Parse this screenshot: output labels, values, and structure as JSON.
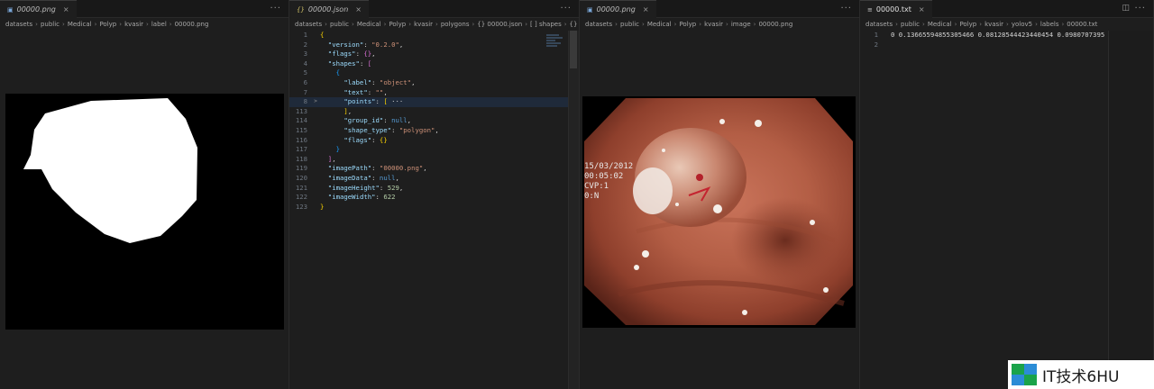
{
  "panes": {
    "mask": {
      "tab_label": "00000.png",
      "breadcrumbs": [
        "datasets",
        "public",
        "Medical",
        "Polyp",
        "kvasir",
        "label",
        "00000.png"
      ]
    },
    "json": {
      "tab_label": "00000.json",
      "breadcrumbs": [
        "datasets",
        "public",
        "Medical",
        "Polyp",
        "kvasir",
        "polygons",
        "{} 00000.json",
        "[ ] shapes",
        "{} 0"
      ],
      "lines": [
        {
          "n": "1",
          "segs": [
            [
              "b",
              "{"
            ]
          ]
        },
        {
          "n": "2",
          "segs": [
            [
              "t",
              "  "
            ],
            [
              "k",
              "\"version\""
            ],
            [
              "t",
              ": "
            ],
            [
              "s",
              "\"0.2.0\""
            ],
            [
              "t",
              ","
            ]
          ]
        },
        {
          "n": "3",
          "segs": [
            [
              "t",
              "  "
            ],
            [
              "k",
              "\"flags\""
            ],
            [
              "t",
              ": "
            ],
            [
              "b2",
              "{}"
            ],
            [
              "t",
              ","
            ]
          ]
        },
        {
          "n": "4",
          "segs": [
            [
              "t",
              "  "
            ],
            [
              "k",
              "\"shapes\""
            ],
            [
              "t",
              ": "
            ],
            [
              "b2",
              "["
            ]
          ]
        },
        {
          "n": "5",
          "segs": [
            [
              "t",
              "    "
            ],
            [
              "b3",
              "{"
            ]
          ]
        },
        {
          "n": "6",
          "segs": [
            [
              "t",
              "      "
            ],
            [
              "k",
              "\"label\""
            ],
            [
              "t",
              ": "
            ],
            [
              "s",
              "\"object\""
            ],
            [
              "t",
              ","
            ]
          ]
        },
        {
          "n": "7",
          "segs": [
            [
              "t",
              "      "
            ],
            [
              "k",
              "\"text\""
            ],
            [
              "t",
              ": "
            ],
            [
              "s",
              "\"\""
            ],
            [
              "t",
              ","
            ]
          ]
        },
        {
          "n": "8",
          "fold": ">",
          "hl": true,
          "segs": [
            [
              "t",
              "      "
            ],
            [
              "k",
              "\"points\""
            ],
            [
              "t",
              ": "
            ],
            [
              "b",
              "["
            ],
            [
              "t",
              " ··· "
            ]
          ]
        },
        {
          "n": "113",
          "segs": [
            [
              "t",
              "      "
            ],
            [
              "b",
              "]"
            ],
            [
              "t",
              ","
            ]
          ]
        },
        {
          "n": "114",
          "segs": [
            [
              "t",
              "      "
            ],
            [
              "k",
              "\"group_id\""
            ],
            [
              "t",
              ": "
            ],
            [
              "nl",
              "null"
            ],
            [
              "t",
              ","
            ]
          ]
        },
        {
          "n": "115",
          "segs": [
            [
              "t",
              "      "
            ],
            [
              "k",
              "\"shape_type\""
            ],
            [
              "t",
              ": "
            ],
            [
              "s",
              "\"polygon\""
            ],
            [
              "t",
              ","
            ]
          ]
        },
        {
          "n": "116",
          "segs": [
            [
              "t",
              "      "
            ],
            [
              "k",
              "\"flags\""
            ],
            [
              "t",
              ": "
            ],
            [
              "b",
              "{}"
            ]
          ]
        },
        {
          "n": "117",
          "segs": [
            [
              "t",
              "    "
            ],
            [
              "b3",
              "}"
            ]
          ]
        },
        {
          "n": "118",
          "segs": [
            [
              "t",
              "  "
            ],
            [
              "b2",
              "]"
            ],
            [
              "t",
              ","
            ]
          ]
        },
        {
          "n": "119",
          "segs": [
            [
              "t",
              "  "
            ],
            [
              "k",
              "\"imagePath\""
            ],
            [
              "t",
              ": "
            ],
            [
              "s",
              "\"00000.png\""
            ],
            [
              "t",
              ","
            ]
          ]
        },
        {
          "n": "120",
          "segs": [
            [
              "t",
              "  "
            ],
            [
              "k",
              "\"imageData\""
            ],
            [
              "t",
              ": "
            ],
            [
              "nl",
              "null"
            ],
            [
              "t",
              ","
            ]
          ]
        },
        {
          "n": "121",
          "segs": [
            [
              "t",
              "  "
            ],
            [
              "k",
              "\"imageHeight\""
            ],
            [
              "t",
              ": "
            ],
            [
              "n",
              "529"
            ],
            [
              "t",
              ","
            ]
          ]
        },
        {
          "n": "122",
          "segs": [
            [
              "t",
              "  "
            ],
            [
              "k",
              "\"imageWidth\""
            ],
            [
              "t",
              ": "
            ],
            [
              "n",
              "622"
            ]
          ]
        },
        {
          "n": "123",
          "segs": [
            [
              "b",
              "}"
            ]
          ]
        }
      ]
    },
    "image": {
      "tab_label": "00000.png",
      "breadcrumbs": [
        "datasets",
        "public",
        "Medical",
        "Polyp",
        "kvasir",
        "image",
        "00000.png"
      ],
      "overlay_text": [
        "15/03/2012",
        "00:05:02",
        "CVP:1",
        "0:N"
      ]
    },
    "txt": {
      "tab_label": "00000.txt",
      "breadcrumbs": [
        "datasets",
        "public",
        "Medical",
        "Polyp",
        "kvasir",
        "yolov5",
        "labels",
        "00000.txt"
      ],
      "lines": [
        {
          "n": "1",
          "text": "0 0.13665594855305466 0.08128544423440454 0.0980707395"
        },
        {
          "n": "2",
          "text": ""
        }
      ]
    }
  },
  "watermark": {
    "text": "IT技术6HU"
  },
  "colors": {
    "editor_bg": "#1e1e1e",
    "tabbar_bg": "#181818",
    "accent": "#7aa7d8"
  }
}
